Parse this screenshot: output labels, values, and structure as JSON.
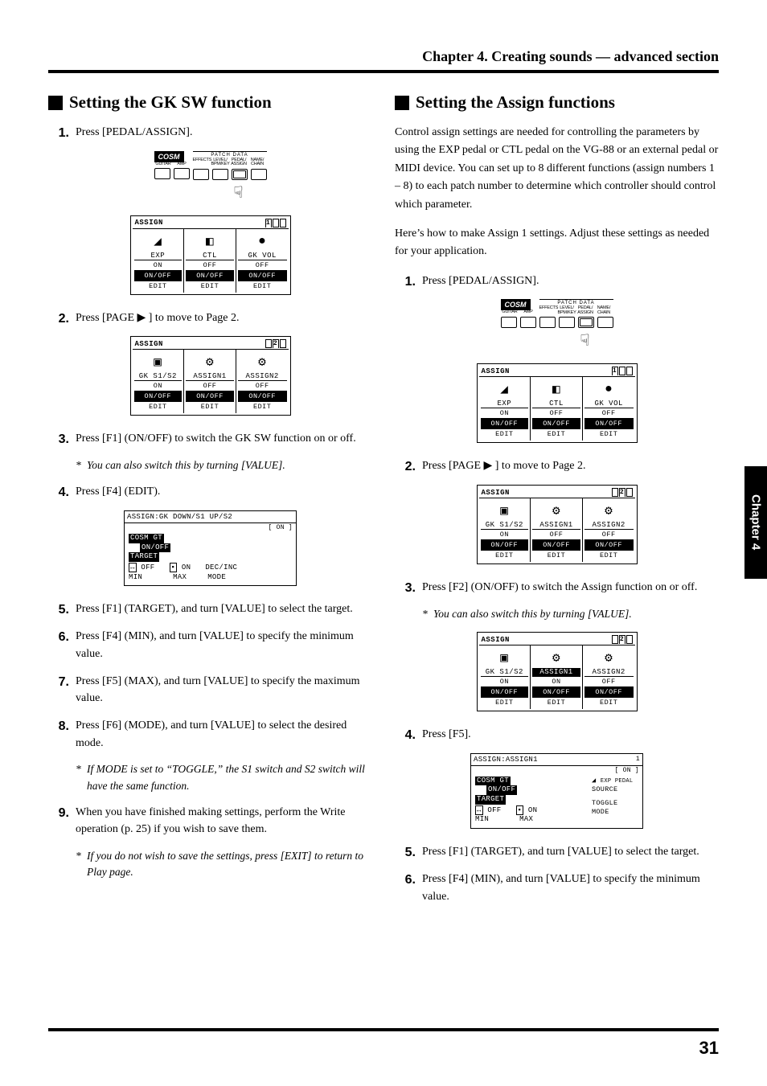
{
  "header": {
    "chapter_title": "Chapter 4. Creating sounds — advanced section"
  },
  "side_tab": "Chapter 4",
  "page_number": "31",
  "patch_strip": {
    "brand": "COSM",
    "section_label": "PATCH DATA",
    "labels": [
      "GUITAR",
      "AMP",
      "EFFECTS",
      "LEVEL/ BPM/KEY",
      "PEDAL/ ASSIGN",
      "NAME/ CHAIN"
    ]
  },
  "assign_screen": {
    "title": "ASSIGN",
    "cells": [
      {
        "icon": "pedal",
        "label": "EXP",
        "val": "ON",
        "onoff": "ON/OFF",
        "edit": "EDIT"
      },
      {
        "icon": "switch",
        "label": "CTL",
        "val": "OFF",
        "onoff": "ON/OFF",
        "edit": "EDIT"
      },
      {
        "icon": "knob",
        "label": "GK VOL",
        "val": "OFF",
        "onoff": "ON/OFF",
        "edit": "EDIT"
      }
    ]
  },
  "assign_screen_p2": {
    "title": "ASSIGN",
    "cells": [
      {
        "icon": "switch2",
        "label": "GK S1/S2",
        "val": "ON",
        "onoff": "ON/OFF",
        "edit": "EDIT"
      },
      {
        "icon": "assign",
        "label": "ASSIGN1",
        "val": "OFF",
        "onoff": "ON/OFF",
        "edit": "EDIT"
      },
      {
        "icon": "assign",
        "label": "ASSIGN2",
        "val": "OFF",
        "onoff": "ON/OFF",
        "edit": "EDIT"
      }
    ]
  },
  "assign_screen_p2_sel": {
    "title": "ASSIGN",
    "cells": [
      {
        "icon": "switch2",
        "label": "GK S1/S2",
        "val": "ON",
        "onoff": "ON/OFF",
        "edit": "EDIT"
      },
      {
        "icon": "assign",
        "label": "ASSIGN1",
        "val": "ON",
        "onoff": "ON/OFF",
        "edit": "EDIT",
        "sel": true
      },
      {
        "icon": "assign",
        "label": "ASSIGN2",
        "val": "OFF",
        "onoff": "ON/OFF",
        "edit": "EDIT"
      }
    ]
  },
  "gk_edit_screen": {
    "title": "ASSIGN:GK DOWN/S1 UP/S2",
    "status": "[ ON ]",
    "target_lbl": "COSM GT",
    "target_sub": "ON/OFF",
    "target_txt": "TARGET",
    "min": "OFF",
    "max": "ON",
    "mode": "DEC/INC",
    "min_lbl": "MIN",
    "max_lbl": "MAX",
    "mode_lbl": "MODE"
  },
  "assign1_edit_screen": {
    "title": "ASSIGN:ASSIGN1",
    "status": "[ ON ]",
    "source_val": "EXP PEDAL",
    "source_lbl": "SOURCE",
    "target_lbl": "COSM GT",
    "target_sub": "ON/OFF",
    "target_txt": "TARGET",
    "min": "OFF",
    "max": "ON",
    "mode": "TOGGLE",
    "min_lbl": "MIN",
    "max_lbl": "MAX",
    "mode_lbl": "MODE"
  },
  "left": {
    "title": "Setting the GK SW function",
    "steps": {
      "s1": "Press [PEDAL/ASSIGN].",
      "s2": "Press [PAGE ▶ ] to move to Page 2.",
      "s3": "Press [F1] (ON/OFF) to switch the GK SW function on or off.",
      "s3_note": "You can also switch this by turning [VALUE].",
      "s4": "Press [F4] (EDIT).",
      "s5": "Press [F1] (TARGET), and turn [VALUE] to select the target.",
      "s6": "Press [F4] (MIN), and turn [VALUE] to specify the minimum value.",
      "s7": "Press [F5] (MAX), and turn [VALUE] to specify the maximum value.",
      "s8": "Press [F6] (MODE), and turn [VALUE] to select the desired mode.",
      "s8_note": "If MODE is set to “TOGGLE,” the S1 switch and S2 switch will have the same function.",
      "s9": "When you have finished making settings, perform the Write operation (p. 25) if you wish to save them.",
      "s9_note": "If you do not wish to save the settings, press [EXIT] to return to Play page."
    }
  },
  "right": {
    "title": "Setting the Assign functions",
    "intro1": "Control assign settings are needed for controlling the parameters by using the EXP pedal or CTL pedal on the VG-88 or an external pedal or MIDI device. You can set up to 8 different functions (assign numbers 1 – 8) to each patch number to determine which controller should control which parameter.",
    "intro2": "Here’s how to make Assign 1 settings. Adjust these settings as needed for your application.",
    "steps": {
      "s1": "Press [PEDAL/ASSIGN].",
      "s2": "Press [PAGE ▶ ] to move to Page 2.",
      "s3": "Press [F2] (ON/OFF) to switch the Assign function on or off.",
      "s3_note": "You can also switch this by turning [VALUE].",
      "s4": "Press [F5].",
      "s5": "Press [F1] (TARGET), and turn [VALUE] to select the target.",
      "s6": "Press [F4] (MIN), and turn [VALUE] to specify the minimum value."
    }
  }
}
